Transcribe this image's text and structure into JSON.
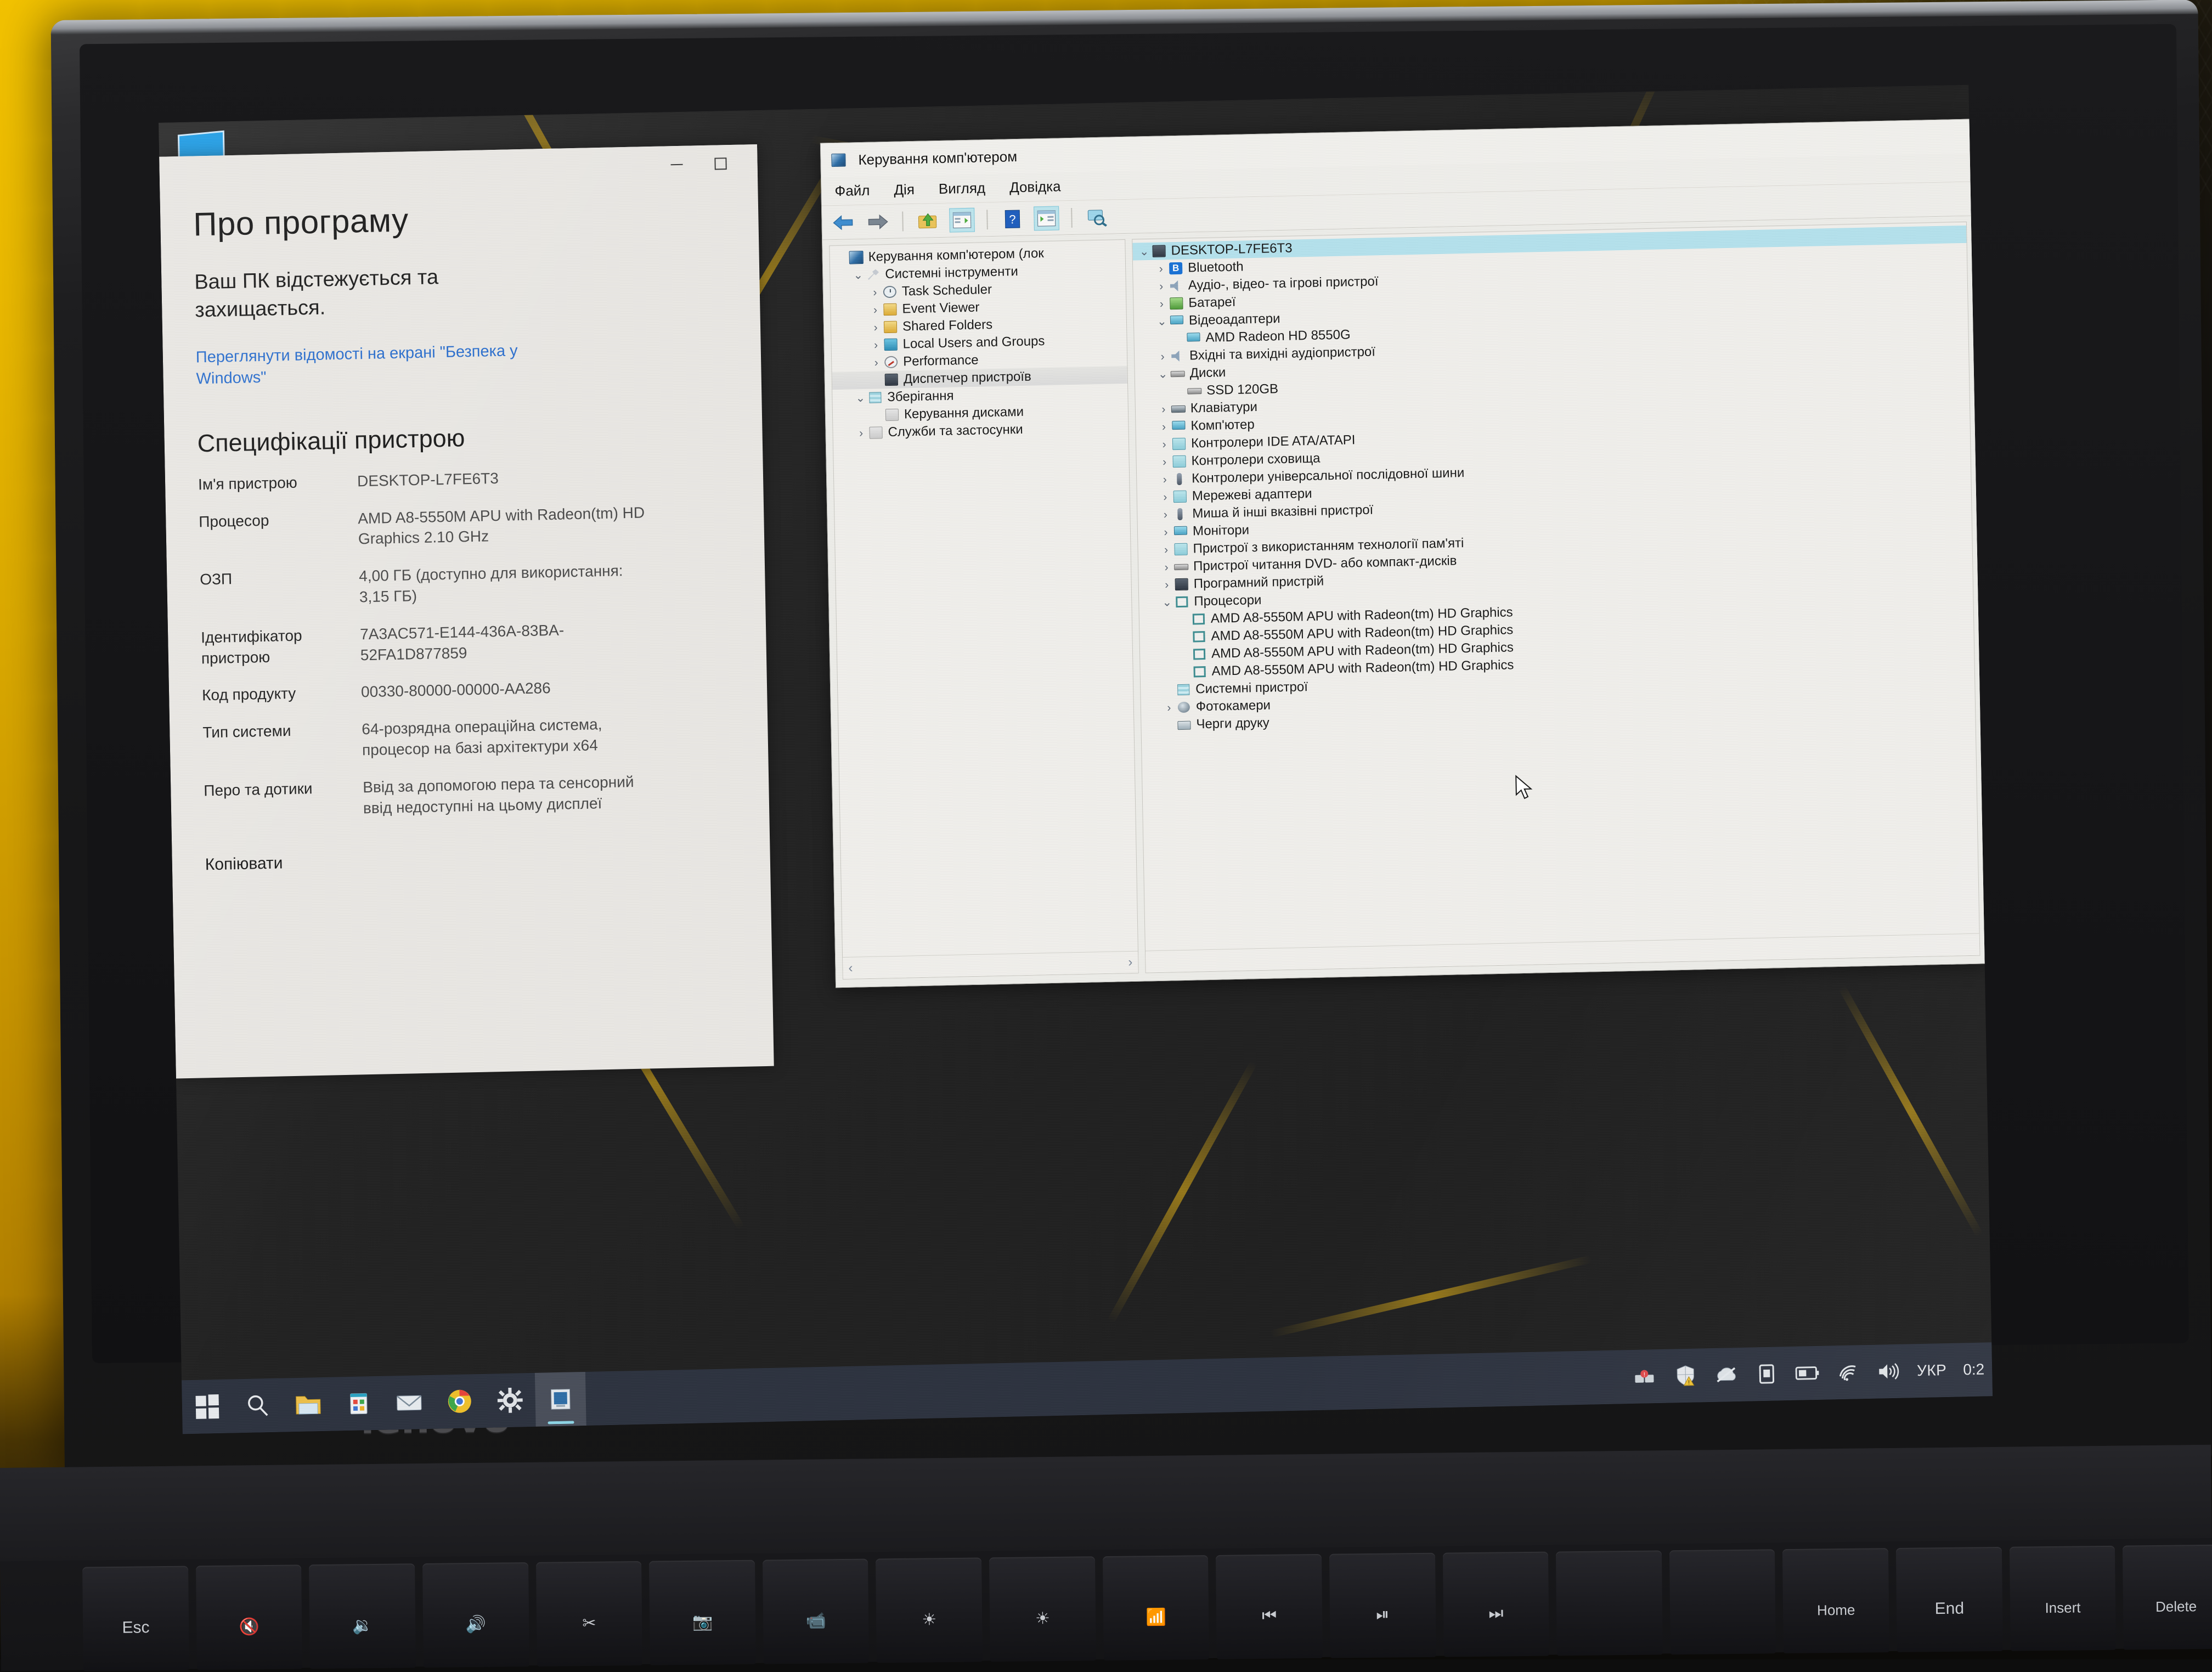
{
  "settings_window": {
    "window_controls": {
      "minimize": "–",
      "maximize": "□"
    },
    "page_title": "Про програму",
    "protection_heading": "Ваш ПК відстежується та захищається.",
    "security_link": "Переглянути відомості на екрані \"Безпека у Windows\"",
    "specs_heading": "Специфікації пристрою",
    "specs": [
      {
        "label": "Ім'я пристрою",
        "value": "DESKTOP-L7FE6T3"
      },
      {
        "label": "Процесор",
        "value": "AMD A8-5550M APU with Radeon(tm) HD Graphics    2.10 GHz"
      },
      {
        "label": "ОЗП",
        "value": "4,00 ГБ (доступно для використання: 3,15 ГБ)"
      },
      {
        "label": "Ідентифікатор пристрою",
        "value": "7A3AC571-E144-436A-83BA-52FA1D877859"
      },
      {
        "label": "Код продукту",
        "value": "00330-80000-00000-AA286"
      },
      {
        "label": "Тип системи",
        "value": "64-розрядна операційна система, процесор на базі архітектури x64"
      },
      {
        "label": "Перо та дотики",
        "value": "Ввід за допомогою пера та сенсорний ввід недоступні на цьому дисплеї"
      }
    ],
    "copy_button": "Копіювати"
  },
  "computer_management": {
    "title": "Керування комп'ютером",
    "menu": [
      "Файл",
      "Дія",
      "Вигляд",
      "Довідка"
    ],
    "toolbar_icons": [
      "back-arrow",
      "forward-arrow",
      "up-folder",
      "show-hide-console-tree",
      "help",
      "properties",
      "scan-hardware"
    ],
    "tree_scroll_left": "‹",
    "tree_scroll_right": "›",
    "tree": [
      {
        "label": "Керування комп'ютером (лок",
        "indent": 0,
        "chev": "",
        "icon": "mmc-icon",
        "state": ""
      },
      {
        "label": "Системні інструменти",
        "indent": 1,
        "chev": "v",
        "icon": "tools-icon",
        "state": ""
      },
      {
        "label": "Task Scheduler",
        "indent": 2,
        "chev": ">",
        "icon": "clock-icon",
        "state": ""
      },
      {
        "label": "Event Viewer",
        "indent": 2,
        "chev": ">",
        "icon": "event-log-icon",
        "state": ""
      },
      {
        "label": "Shared Folders",
        "indent": 2,
        "chev": ">",
        "icon": "shared-folder-icon",
        "state": ""
      },
      {
        "label": "Local Users and Groups",
        "indent": 2,
        "chev": ">",
        "icon": "users-icon",
        "state": ""
      },
      {
        "label": "Performance",
        "indent": 2,
        "chev": ">",
        "icon": "performance-icon",
        "state": ""
      },
      {
        "label": "Диспетчер пристроїв",
        "indent": 2,
        "chev": "",
        "icon": "device-manager-icon",
        "state": "selected"
      },
      {
        "label": "Зберігання",
        "indent": 1,
        "chev": "v",
        "icon": "storage-icon",
        "state": ""
      },
      {
        "label": "Керування дисками",
        "indent": 2,
        "chev": "",
        "icon": "disk-management-icon",
        "state": ""
      },
      {
        "label": "Служби та застосунки",
        "indent": 1,
        "chev": ">",
        "icon": "services-icon",
        "state": ""
      }
    ],
    "devices": [
      {
        "label": "DESKTOP-L7FE6T3",
        "indent": 0,
        "chev": "v",
        "icon": "computer-root-icon",
        "state": "selected-blue"
      },
      {
        "label": "Bluetooth",
        "indent": 1,
        "chev": ">",
        "icon": "bluetooth-icon",
        "state": ""
      },
      {
        "label": "Аудіо-, відео- та ігрові пристрої",
        "indent": 1,
        "chev": ">",
        "icon": "speaker-icon",
        "state": ""
      },
      {
        "label": "Батареї",
        "indent": 1,
        "chev": ">",
        "icon": "battery-icon",
        "state": ""
      },
      {
        "label": "Відеоадаптери",
        "indent": 1,
        "chev": "v",
        "icon": "display-adapter-icon",
        "state": ""
      },
      {
        "label": "AMD Radeon HD 8550G",
        "indent": 2,
        "chev": "",
        "icon": "display-adapter-icon",
        "state": ""
      },
      {
        "label": "Вхідні та вихідні аудіопристрої",
        "indent": 1,
        "chev": ">",
        "icon": "speaker-icon",
        "state": ""
      },
      {
        "label": "Диски",
        "indent": 1,
        "chev": "v",
        "icon": "disk-drive-icon",
        "state": ""
      },
      {
        "label": "SSD 120GB",
        "indent": 2,
        "chev": "",
        "icon": "disk-drive-icon",
        "state": ""
      },
      {
        "label": "Клавіатури",
        "indent": 1,
        "chev": ">",
        "icon": "keyboard-icon",
        "state": ""
      },
      {
        "label": "Комп'ютер",
        "indent": 1,
        "chev": ">",
        "icon": "monitor-icon",
        "state": ""
      },
      {
        "label": "Контролери IDE ATA/ATAPI",
        "indent": 1,
        "chev": ">",
        "icon": "ide-controller-icon",
        "state": ""
      },
      {
        "label": "Контролери сховища",
        "indent": 1,
        "chev": ">",
        "icon": "storage-controller-icon",
        "state": ""
      },
      {
        "label": "Контролери універсальної послідовної шини",
        "indent": 1,
        "chev": ">",
        "icon": "usb-icon",
        "state": ""
      },
      {
        "label": "Мережеві адаптери",
        "indent": 1,
        "chev": ">",
        "icon": "network-adapter-icon",
        "state": ""
      },
      {
        "label": "Миша й інші вказівні пристрої",
        "indent": 1,
        "chev": ">",
        "icon": "mouse-icon",
        "state": ""
      },
      {
        "label": "Монітори",
        "indent": 1,
        "chev": ">",
        "icon": "monitor-icon",
        "state": ""
      },
      {
        "label": "Пристрої з використанням технології пам'яті",
        "indent": 1,
        "chev": ">",
        "icon": "memory-device-icon",
        "state": ""
      },
      {
        "label": "Пристрої читання DVD- або компакт-дисків",
        "indent": 1,
        "chev": ">",
        "icon": "dvd-drive-icon",
        "state": ""
      },
      {
        "label": "Програмний пристрій",
        "indent": 1,
        "chev": ">",
        "icon": "software-device-icon",
        "state": ""
      },
      {
        "label": "Процесори",
        "indent": 1,
        "chev": "v",
        "icon": "processor-icon",
        "state": ""
      },
      {
        "label": "AMD A8-5550M APU with Radeon(tm) HD Graphics",
        "indent": 2,
        "chev": "",
        "icon": "processor-icon",
        "state": ""
      },
      {
        "label": "AMD A8-5550M APU with Radeon(tm) HD Graphics",
        "indent": 2,
        "chev": "",
        "icon": "processor-icon",
        "state": ""
      },
      {
        "label": "AMD A8-5550M APU with Radeon(tm) HD Graphics",
        "indent": 2,
        "chev": "",
        "icon": "processor-icon",
        "state": ""
      },
      {
        "label": "AMD A8-5550M APU with Radeon(tm) HD Graphics",
        "indent": 2,
        "chev": "",
        "icon": "processor-icon",
        "state": ""
      },
      {
        "label": "Системні пристрої",
        "indent": 1,
        "chev": "",
        "icon": "system-device-icon",
        "state": ""
      },
      {
        "label": "Фотокамери",
        "indent": 1,
        "chev": ">",
        "icon": "camera-icon",
        "state": ""
      },
      {
        "label": "Черги друку",
        "indent": 1,
        "chev": "",
        "icon": "print-queue-icon",
        "state": ""
      }
    ]
  },
  "desktop": {
    "icons": [
      {
        "label": "",
        "name": "this-pc-icon"
      }
    ]
  },
  "taskbar": {
    "pinned": [
      {
        "name": "start-button-icon"
      },
      {
        "name": "search-icon"
      },
      {
        "name": "file-explorer-icon"
      },
      {
        "name": "microsoft-store-icon"
      },
      {
        "name": "mail-icon"
      },
      {
        "name": "google-chrome-icon"
      },
      {
        "name": "settings-gear-icon"
      },
      {
        "name": "computer-management-icon"
      }
    ],
    "tray": [
      {
        "name": "network-problem-icon"
      },
      {
        "name": "windows-security-warning-icon"
      },
      {
        "name": "onedrive-offline-icon"
      },
      {
        "name": "tablet-mode-icon"
      },
      {
        "name": "battery-icon"
      },
      {
        "name": "wifi-icon"
      },
      {
        "name": "volume-icon"
      }
    ],
    "language": "УКР",
    "clock": "0:2"
  },
  "laptop": {
    "brand": "lenovo",
    "keys": [
      "Esc",
      "",
      "",
      "",
      "",
      "",
      "",
      "",
      "",
      "",
      "",
      "",
      "",
      "",
      "",
      "Home",
      "End",
      "Insert",
      "Delete"
    ]
  }
}
